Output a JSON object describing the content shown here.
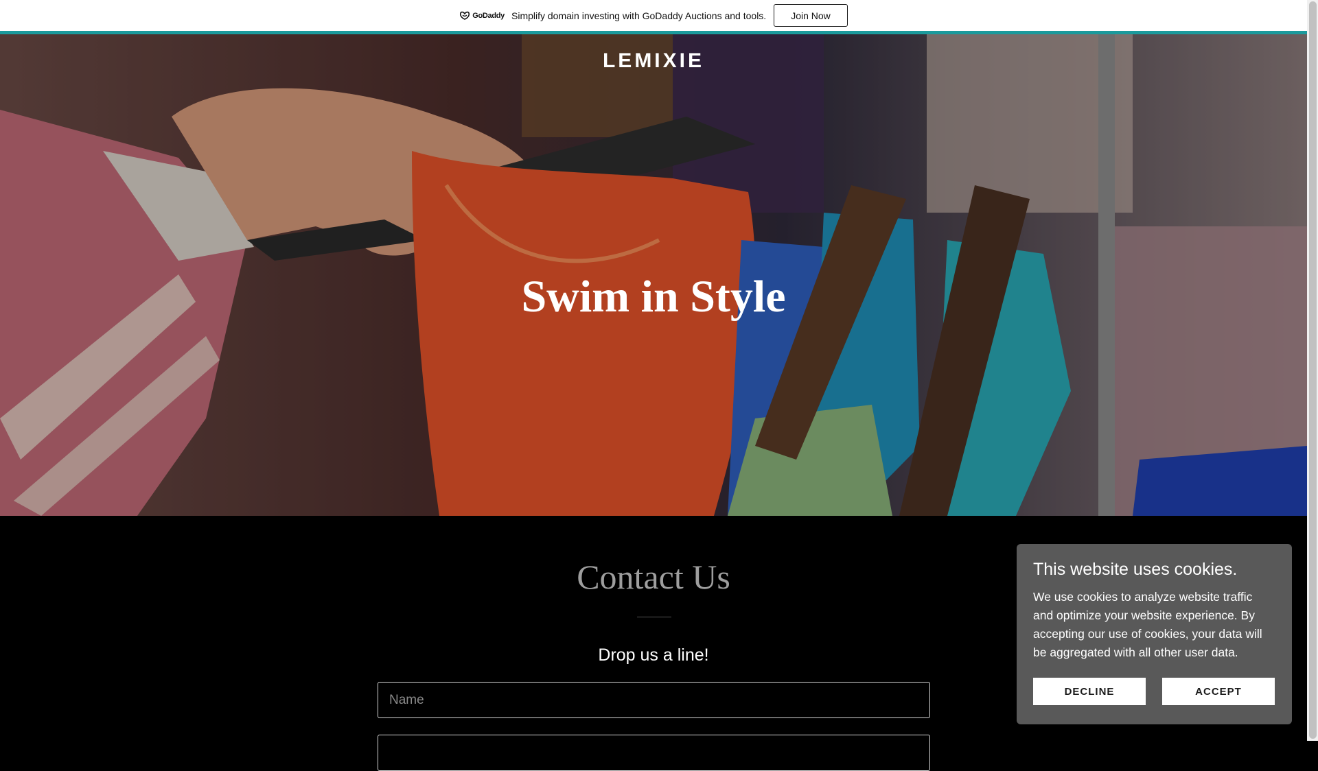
{
  "promo": {
    "logo_text": "GoDaddy",
    "text": "Simplify domain investing with GoDaddy Auctions and tools.",
    "button_label": "Join Now",
    "accent_color": "#1b9a9c"
  },
  "hero": {
    "site_title": "LEMIXIE",
    "heading": "Swim in Style",
    "image_icon": "clothing-rack-photo"
  },
  "contact": {
    "title": "Contact Us",
    "subtitle": "Drop us a line!",
    "name_placeholder": "Name"
  },
  "cookies": {
    "title": "This website uses cookies.",
    "text": "We use cookies to analyze website traffic and optimize your website experience. By accepting our use of cookies, your data will be aggregated with all other user data.",
    "decline_label": "DECLINE",
    "accept_label": "ACCEPT"
  }
}
